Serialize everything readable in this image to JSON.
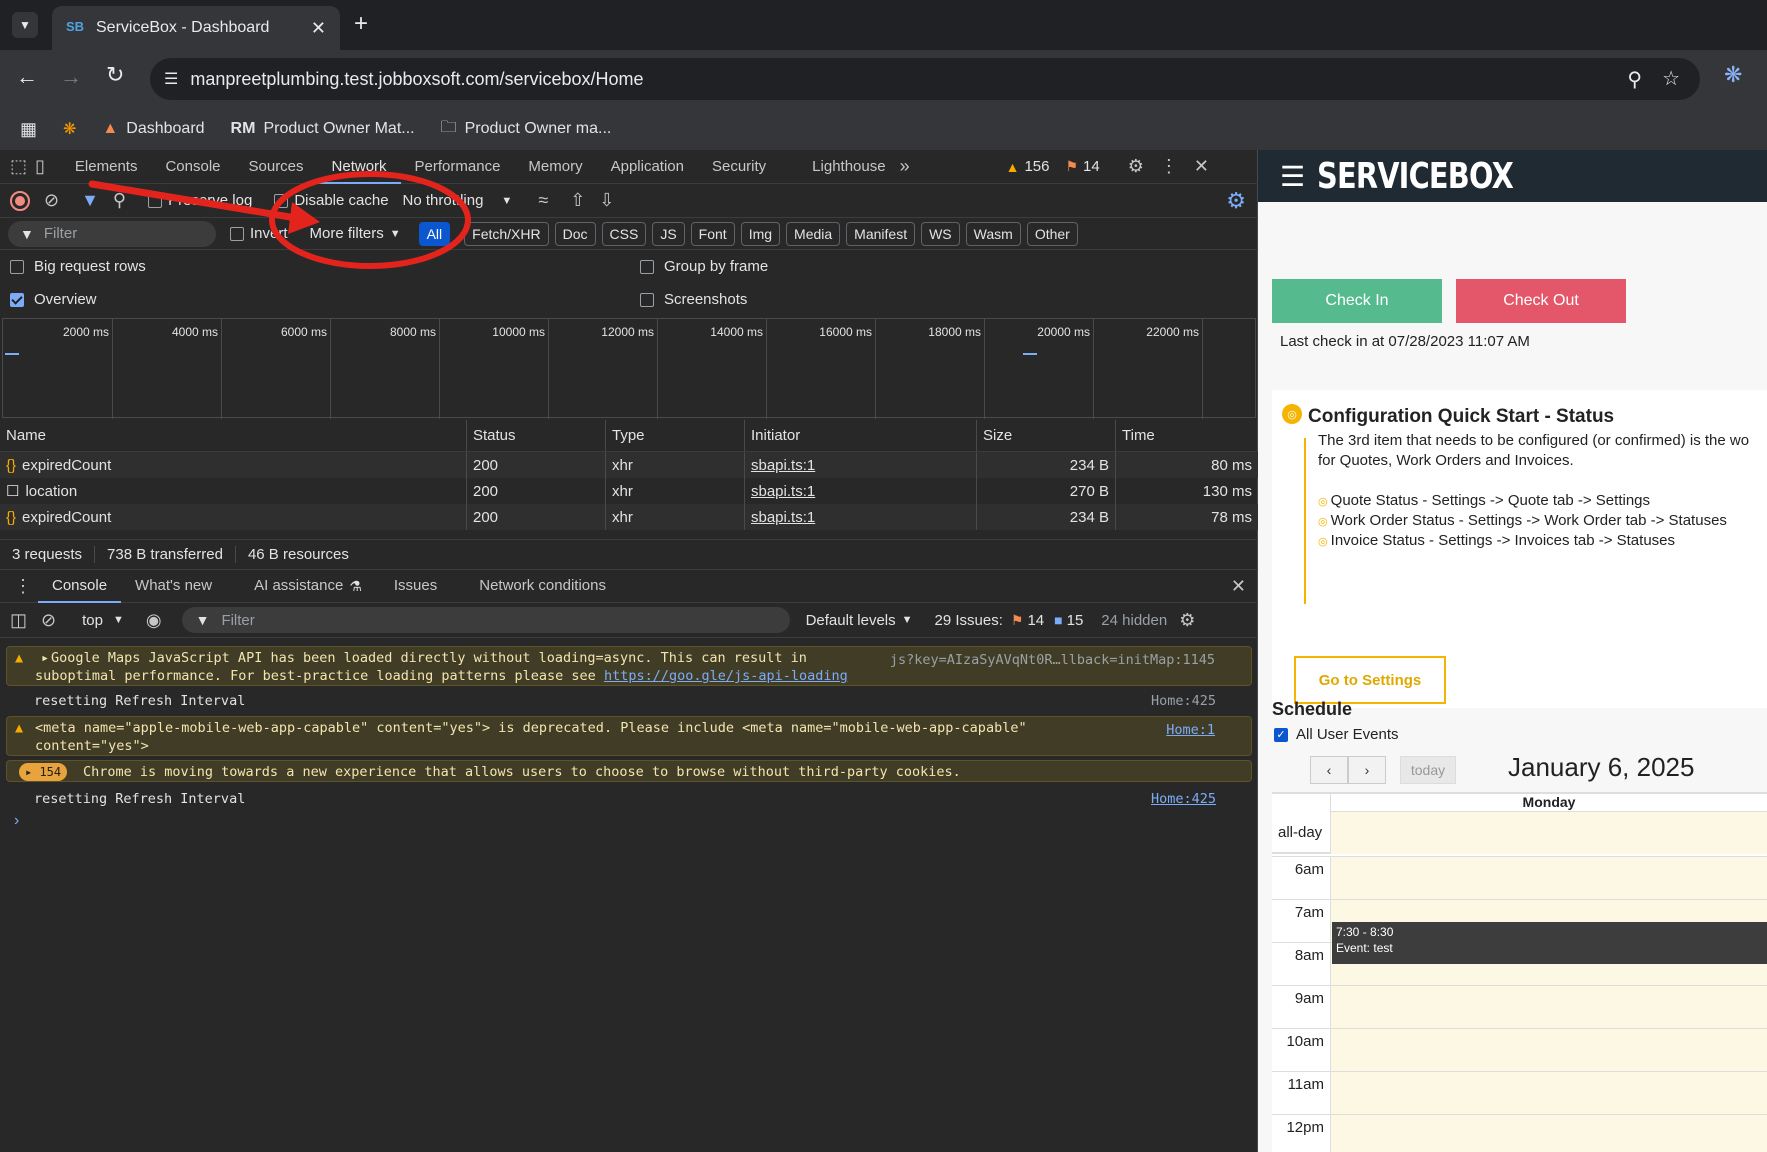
{
  "browser": {
    "tab_title": "ServiceBox - Dashboard",
    "tab_favicon": "SB",
    "url": "manpreetplumbing.test.jobboxsoft.com/servicebox/Home",
    "bookmarks": [
      {
        "label": "Dashboard"
      },
      {
        "label": "Product Owner Mat..."
      },
      {
        "label": "Product Owner ma..."
      }
    ]
  },
  "devtools": {
    "tabs": [
      "Elements",
      "Console",
      "Sources",
      "Network",
      "Performance",
      "Memory",
      "Application",
      "Security",
      "Lighthouse"
    ],
    "warnings_count": "156",
    "errors_count": "14",
    "network": {
      "preserve_log_label": "Preserve log",
      "disable_cache_label": "Disable cache",
      "throttling": "No throttling",
      "filter_placeholder": "Filter",
      "invert_label": "Invert",
      "more_filters": "More filters",
      "type_filters": [
        "All",
        "Fetch/XHR",
        "Doc",
        "CSS",
        "JS",
        "Font",
        "Img",
        "Media",
        "Manifest",
        "WS",
        "Wasm",
        "Other"
      ],
      "big_request_rows": "Big request rows",
      "group_by_frame": "Group by frame",
      "overview": "Overview",
      "screenshots": "Screenshots",
      "timeline_ticks": [
        "2000 ms",
        "4000 ms",
        "6000 ms",
        "8000 ms",
        "10000 ms",
        "12000 ms",
        "14000 ms",
        "16000 ms",
        "18000 ms",
        "20000 ms",
        "22000 ms"
      ],
      "columns": [
        "Name",
        "Status",
        "Type",
        "Initiator",
        "Size",
        "Time"
      ],
      "rows": [
        {
          "name": "expiredCount",
          "status": "200",
          "type": "xhr",
          "initiator": "sbapi.ts:1",
          "size": "234 B",
          "time": "80 ms"
        },
        {
          "name": "location",
          "status": "200",
          "type": "xhr",
          "initiator": "sbapi.ts:1",
          "size": "270 B",
          "time": "130 ms"
        },
        {
          "name": "expiredCount",
          "status": "200",
          "type": "xhr",
          "initiator": "sbapi.ts:1",
          "size": "234 B",
          "time": "78 ms"
        }
      ],
      "summary": {
        "requests": "3 requests",
        "transferred": "738 B transferred",
        "resources": "46 B resources"
      }
    },
    "drawer": {
      "tabs": [
        "Console",
        "What's new",
        "AI assistance",
        "Issues",
        "Network conditions"
      ],
      "context": "top",
      "filter_placeholder": "Filter",
      "levels": "Default levels",
      "issues_label": "29 Issues:",
      "issues_warn": "14",
      "issues_info": "15",
      "hidden": "24 hidden"
    },
    "console": {
      "msg1_line1": "Google Maps JavaScript API has been loaded directly without loading=async. This can result in",
      "msg1_line2_pre": "suboptimal performance. For best-practice loading patterns please see ",
      "msg1_link": "https://goo.gle/js-api-loading",
      "msg1_src": "js?key=AIzaSyAVqNt0R…llback=initMap:1145",
      "msg2": "resetting Refresh Interval",
      "msg2_src": "Home:425",
      "msg3_line1": "<meta name=\"apple-mobile-web-app-capable\" content=\"yes\"> is deprecated. Please include <meta name=\"mobile-web-app-capable\"",
      "msg3_line2": "content=\"yes\">",
      "msg3_src": "Home:1",
      "msg4_count": "154",
      "msg4": "Chrome is moving towards a new experience that allows users to choose to browse without third-party cookies.",
      "msg5": "resetting Refresh Interval",
      "msg5_src": "Home:425"
    }
  },
  "app": {
    "brand": "SERVICEBOX",
    "check_in": "Check In",
    "check_out": "Check Out",
    "last_check_in": "Last check in at 07/28/2023 11:07 AM",
    "config_title": "Configuration Quick Start - Status",
    "config_text_1": "The 3rd item that needs to be configured (or confirmed) is the wo",
    "config_text_2": "for Quotes, Work Orders and Invoices.",
    "config_items": [
      "Quote Status - Settings -> Quote tab -> Settings",
      "Work Order Status - Settings -> Work Order tab -> Statuses",
      "Invoice Status - Settings -> Invoices tab -> Statuses"
    ],
    "go_settings": "Go to Settings",
    "schedule_title": "Schedule",
    "all_user_events": "All User Events",
    "today_btn": "today",
    "cal_date": "January 6, 2025",
    "cal_day": "Monday",
    "all_day": "all-day",
    "hours": [
      "6am",
      "7am",
      "8am",
      "9am",
      "10am",
      "11am",
      "12pm"
    ],
    "event_time": "7:30 - 8:30",
    "event_title": "Event: test"
  },
  "colors": {
    "check_in": "#55bb8e",
    "check_out": "#e4576a",
    "accent": "#f4b400",
    "app_header": "#1f2a33"
  }
}
